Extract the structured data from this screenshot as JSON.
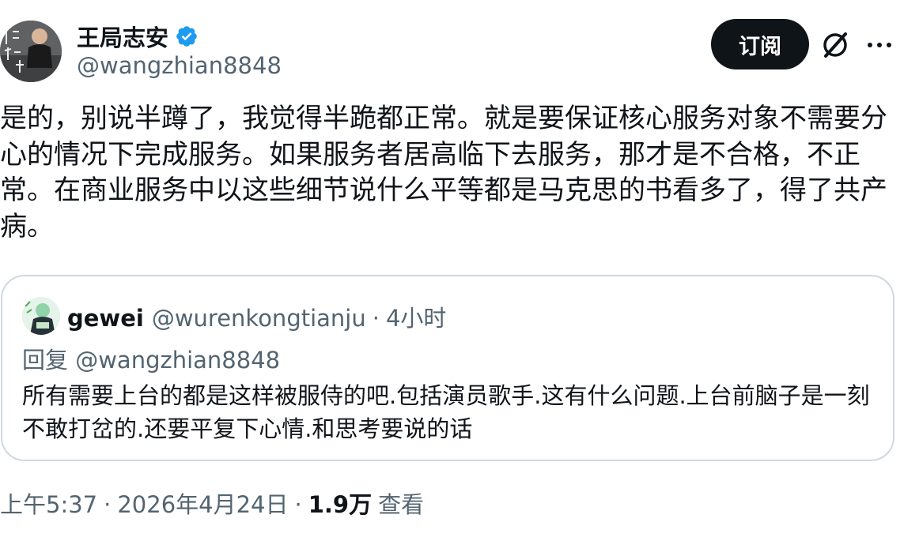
{
  "author": {
    "name": "王局志安",
    "handle": "@wangzhian8848",
    "verified": true,
    "avatar_icon": "profile-photo"
  },
  "actions": {
    "subscribe_label": "订阅",
    "grok_icon": "grok-icon",
    "more_icon": "more-horizontal-icon"
  },
  "tweet": {
    "text": "是的，别说半蹲了，我觉得半跪都正常。就是要保证核心服务对象不需要分心的情况下完成服务。如果服务者居高临下去服务，那才是不合格，不正常。在商业服务中以这些细节说什么平等都是马克思的书看多了，得了共产病。"
  },
  "quote": {
    "name": "gewei",
    "handle": "@wurenkongtianju",
    "separator": "·",
    "time": "4小时",
    "reply_to": "回复 @wangzhian8848",
    "text": "所有需要上台的都是这样被服侍的吧.包括演员歌手.这有什么问题.上台前脑子是一刻不敢打岔的.还要平复下心情.和思考要说的话"
  },
  "meta": {
    "time": "上午5:37",
    "separator": "·",
    "date": "2026年4月24日",
    "views_count": "1.9万",
    "views_label": "查看"
  },
  "colors": {
    "text_primary": "#0f1419",
    "text_secondary": "#536471",
    "verified_blue": "#1d9bf0",
    "border": "#cfd9de",
    "button_bg": "#0f1419"
  }
}
